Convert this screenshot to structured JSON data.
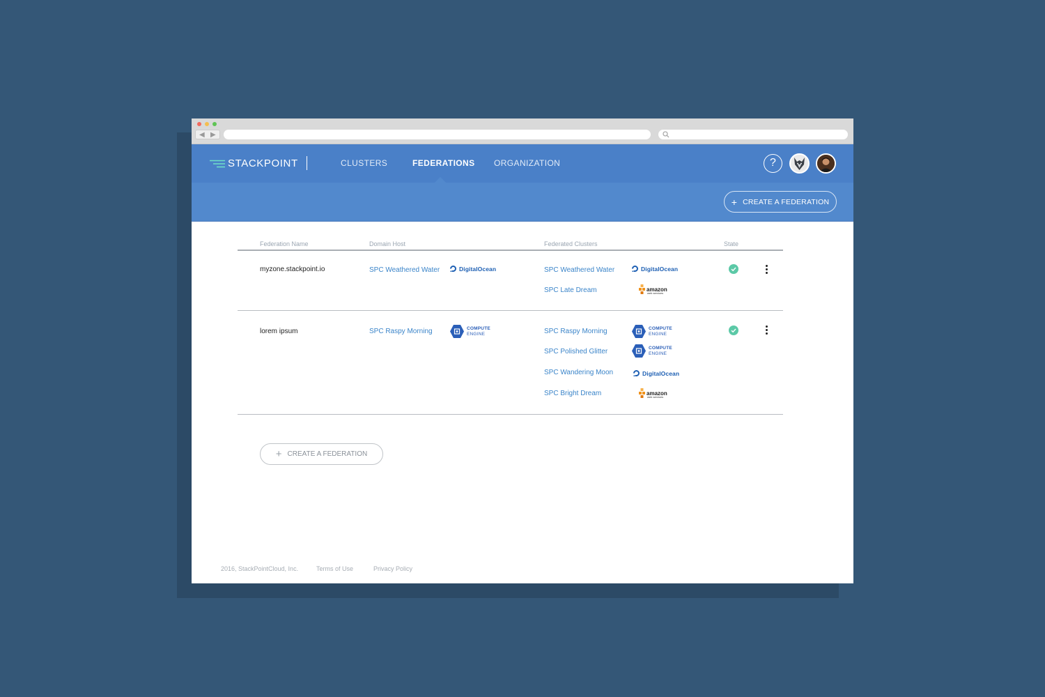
{
  "header": {
    "logo_text": "STACKPOINT",
    "nav": [
      {
        "label": "CLUSTERS",
        "active": false
      },
      {
        "label": "FEDERATIONS",
        "active": true
      },
      {
        "label": "ORGANIZATION",
        "active": false
      }
    ],
    "help_label": "?"
  },
  "subheader": {
    "create_button_label": "CREATE A FEDERATION",
    "create_button_icon": "+"
  },
  "table": {
    "columns": [
      "Federation Name",
      "Domain Host",
      "Federated Clusters",
      "State"
    ],
    "rows": [
      {
        "name": "myzone.stackpoint.io",
        "domain_host": {
          "name": "SPC Weathered Water",
          "provider": "DigitalOcean"
        },
        "clusters": [
          {
            "name": "SPC Weathered Water",
            "provider": "DigitalOcean"
          },
          {
            "name": "SPC Late Dream",
            "provider": "amazon"
          }
        ],
        "state": "ok"
      },
      {
        "name": "lorem ipsum",
        "domain_host": {
          "name": "SPC Raspy Morning",
          "provider": "COMPUTE ENGINE"
        },
        "clusters": [
          {
            "name": "SPC Raspy Morning",
            "provider": "COMPUTE ENGINE"
          },
          {
            "name": "SPC Polished Glitter",
            "provider": "COMPUTE ENGINE"
          },
          {
            "name": "SPC Wandering Moon",
            "provider": "DigitalOcean"
          },
          {
            "name": "SPC Bright Dream",
            "provider": "amazon"
          }
        ],
        "state": "ok"
      }
    ]
  },
  "providers": {
    "digitalocean": "DigitalOcean",
    "gce_line1": "COMPUTE",
    "gce_line2": "ENGINE",
    "aws_line1": "amazon",
    "aws_line2": "web services"
  },
  "main": {
    "create_button_label": "CREATE A FEDERATION",
    "create_button_icon": "+"
  },
  "footer": {
    "copyright": "2016, StackPointCloud, Inc.",
    "terms": "Terms of Use",
    "privacy": "Privacy Policy"
  },
  "colors": {
    "background": "#345777",
    "header": "#4a80c8",
    "subheader": "#5289cd",
    "link": "#3a84c9",
    "state_ok": "#5cc9a7"
  }
}
